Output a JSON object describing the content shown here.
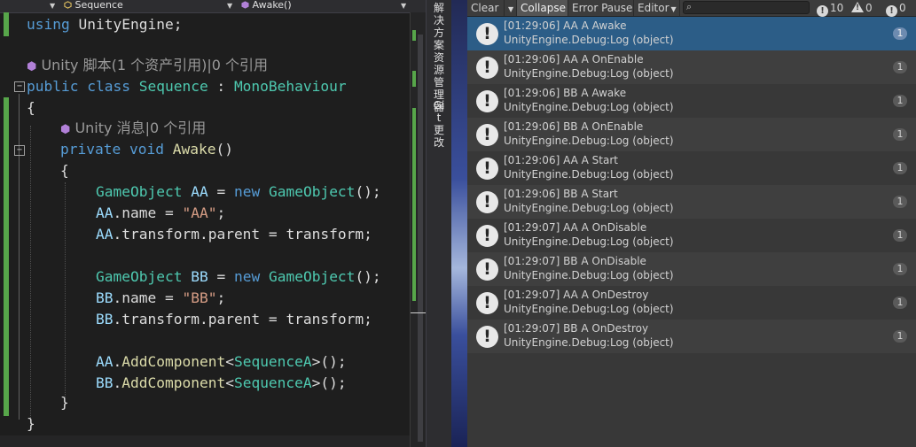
{
  "editor": {
    "nav": {
      "class_dropdown": "Sequence",
      "method_dropdown": "Awake()"
    },
    "code": {
      "using_kw": "using",
      "using_ns": "UnityEngine",
      "semicolon": ";",
      "codelens_class": "Unity 脚本(1 个资产引用)|0 个引用",
      "codelens_method": "Unity 消息|0 个引用",
      "public_kw": "public",
      "class_kw": "class",
      "class_name": "Sequence",
      "colon": " : ",
      "base_class": "MonoBehaviour",
      "open_brace": "{",
      "close_brace": "}",
      "private_kw": "private",
      "void_kw": "void",
      "method_name": "Awake",
      "parens": "()",
      "go_type": "GameObject",
      "new_kw": "new",
      "var_aa": "AA",
      "var_bb": "BB",
      "eq": " = ",
      "name_prop": ".name",
      "str_aa": "\"AA\"",
      "str_bb": "\"BB\"",
      "transform_parent": ".transform.parent",
      "transform": "transform",
      "add_component": "AddComponent",
      "dot": ".",
      "lt": "<",
      "gt": ">",
      "seq_a": "SequenceA",
      "ctor_end": "();"
    }
  },
  "side_tabs": {
    "solution": "解决方案资源管理器",
    "git": "Git 更改"
  },
  "console": {
    "toolbar": {
      "clear": "Clear",
      "collapse": "Collapse",
      "error_pause": "Error Pause",
      "editor": "Editor",
      "log_count": "10",
      "warn_count": "0",
      "error_count": "0"
    },
    "entries": [
      {
        "line1": "[01:29:06] AA A Awake",
        "line2": "UnityEngine.Debug:Log (object)",
        "count": "1"
      },
      {
        "line1": "[01:29:06] AA A OnEnable",
        "line2": "UnityEngine.Debug:Log (object)",
        "count": "1"
      },
      {
        "line1": "[01:29:06] BB A Awake",
        "line2": "UnityEngine.Debug:Log (object)",
        "count": "1"
      },
      {
        "line1": "[01:29:06] BB A OnEnable",
        "line2": "UnityEngine.Debug:Log (object)",
        "count": "1"
      },
      {
        "line1": "[01:29:06] AA A Start",
        "line2": "UnityEngine.Debug:Log (object)",
        "count": "1"
      },
      {
        "line1": "[01:29:06] BB A Start",
        "line2": "UnityEngine.Debug:Log (object)",
        "count": "1"
      },
      {
        "line1": "[01:29:07] AA A OnDisable",
        "line2": "UnityEngine.Debug:Log (object)",
        "count": "1"
      },
      {
        "line1": "[01:29:07] BB A OnDisable",
        "line2": "UnityEngine.Debug:Log (object)",
        "count": "1"
      },
      {
        "line1": "[01:29:07] AA A OnDestroy",
        "line2": "UnityEngine.Debug:Log (object)",
        "count": "1"
      },
      {
        "line1": "[01:29:07] BB A OnDestroy",
        "line2": "UnityEngine.Debug:Log (object)",
        "count": "1"
      }
    ],
    "log_icon": "!"
  },
  "colors": {
    "keyword": "#569cd6",
    "type": "#4ec9b0",
    "method": "#dcdcaa",
    "string": "#d69d85",
    "selected_row": "#2c5d87",
    "change_bar": "#57a64a"
  }
}
